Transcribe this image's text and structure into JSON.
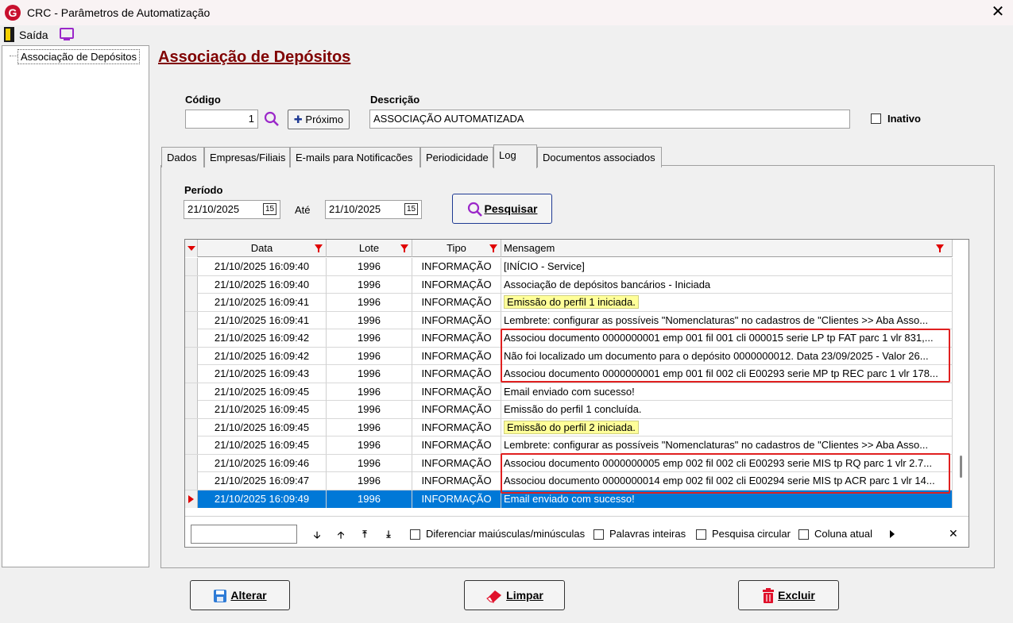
{
  "window": {
    "title": "CRC - Parâmetros de Automatização",
    "logo_letter": "G"
  },
  "menu": {
    "exit_label": "Saída"
  },
  "tree": {
    "items": [
      "Associação de Depósitos"
    ]
  },
  "page": {
    "title": "Associação de Depósitos"
  },
  "form": {
    "codigo_label": "Código",
    "codigo_value": "1",
    "proximo_label": "Próximo",
    "descricao_label": "Descrição",
    "descricao_value": "ASSOCIAÇÃO AUTOMATIZADA",
    "inativo_label": "Inativo"
  },
  "tabs": [
    "Dados",
    "Empresas/Filiais",
    "E-mails para Notificacões",
    "Periodicidade",
    "Log",
    "Documentos associados"
  ],
  "active_tab": "Log",
  "log": {
    "periodo_label": "Período",
    "date_from": "21/10/2025",
    "ate_label": "Até",
    "date_to": "21/10/2025",
    "calendar_icon_text": "15",
    "search_button": "Pesquisar"
  },
  "grid": {
    "columns": [
      "Data",
      "Lote",
      "Tipo",
      "Mensagem"
    ],
    "rows": [
      [
        "21/10/2025 16:09:40",
        "1996",
        "INFORMAÇÃO",
        "[INÍCIO - Service]"
      ],
      [
        "21/10/2025 16:09:40",
        "1996",
        "INFORMAÇÃO",
        "Associação de depósitos bancários - Iniciada"
      ],
      [
        "21/10/2025 16:09:41",
        "1996",
        "INFORMAÇÃO",
        "Emissão do perfil 1 iniciada."
      ],
      [
        "21/10/2025 16:09:41",
        "1996",
        "INFORMAÇÃO",
        "Lembrete: configurar as possíveis \"Nomenclaturas\" no cadastros de \"Clientes >> Aba Asso..."
      ],
      [
        "21/10/2025 16:09:42",
        "1996",
        "INFORMAÇÃO",
        "Associou documento 0000000001 emp 001 fil 001 cli 000015 serie LP tp FAT parc 1 vlr 831,..."
      ],
      [
        "21/10/2025 16:09:42",
        "1996",
        "INFORMAÇÃO",
        "Não foi localizado um documento para o depósito 0000000012. Data 23/09/2025 - Valor 26..."
      ],
      [
        "21/10/2025 16:09:43",
        "1996",
        "INFORMAÇÃO",
        "Associou documento 0000000001 emp 001 fil 002 cli E00293 serie MP tp REC parc 1 vlr 178..."
      ],
      [
        "21/10/2025 16:09:45",
        "1996",
        "INFORMAÇÃO",
        "Email enviado com sucesso!"
      ],
      [
        "21/10/2025 16:09:45",
        "1996",
        "INFORMAÇÃO",
        "Emissão do perfil 1 concluída."
      ],
      [
        "21/10/2025 16:09:45",
        "1996",
        "INFORMAÇÃO",
        "Emissão do perfil 2 iniciada."
      ],
      [
        "21/10/2025 16:09:45",
        "1996",
        "INFORMAÇÃO",
        "Lembrete: configurar as possíveis \"Nomenclaturas\" no cadastros de \"Clientes >> Aba Asso..."
      ],
      [
        "21/10/2025 16:09:46",
        "1996",
        "INFORMAÇÃO",
        "Associou documento 0000000005 emp 002 fil 002 cli E00293 serie MIS tp RQ parc 1 vlr 2.7..."
      ],
      [
        "21/10/2025 16:09:47",
        "1996",
        "INFORMAÇÃO",
        "Associou documento 0000000014 emp 002 fil 002 cli E00294 serie MIS tp ACR parc 1 vlr 14..."
      ],
      [
        "21/10/2025 16:09:49",
        "1996",
        "INFORMAÇÃO",
        "Email enviado com sucesso!"
      ]
    ],
    "highlighted_rows": [
      2,
      9
    ],
    "selected_row": 13
  },
  "search_options": {
    "case": "Diferenciar maiúsculas/minúsculas",
    "whole": "Palavras inteiras",
    "circular": "Pesquisa circular",
    "column": "Coluna atual"
  },
  "buttons": {
    "alterar": "Alterar",
    "limpar": "Limpar",
    "excluir": "Excluir"
  },
  "colors": {
    "title": "#800000",
    "selection": "#0078d7",
    "highlight": "#ffff99",
    "annotation": "#e02020"
  }
}
